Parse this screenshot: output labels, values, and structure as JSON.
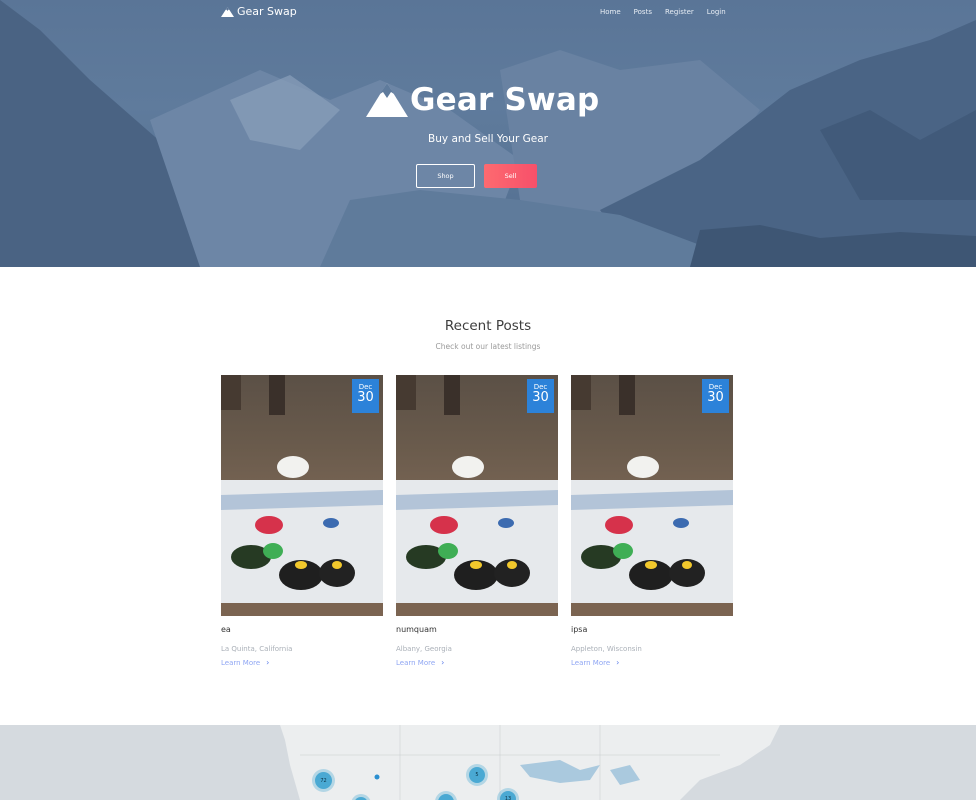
{
  "nav": {
    "brand": "Gear Swap",
    "links": [
      "Home",
      "Posts",
      "Register",
      "Login"
    ]
  },
  "hero": {
    "title": "Gear Swap",
    "subtitle": "Buy and Sell Your Gear",
    "shop_label": "Shop",
    "sell_label": "Sell"
  },
  "recent": {
    "title": "Recent Posts",
    "subtitle": "Check out our latest listings",
    "cards": [
      {
        "month": "Dec",
        "day": "30",
        "title": "ea",
        "location": "La Quinta, California",
        "link": "Learn More"
      },
      {
        "month": "Dec",
        "day": "30",
        "title": "numquam",
        "location": "Albany, Georgia",
        "link": "Learn More"
      },
      {
        "month": "Dec",
        "day": "30",
        "title": "ipsa",
        "location": "Appleton, Wisconsin",
        "link": "Learn More"
      }
    ]
  },
  "map": {
    "clusters": [
      "72",
      "5",
      "13"
    ]
  },
  "colors": {
    "accent_blue": "#2c82d9",
    "sell_pink": "#f7506a",
    "link_blue": "#8fa6f3",
    "hero_blue": "#5a7597"
  }
}
